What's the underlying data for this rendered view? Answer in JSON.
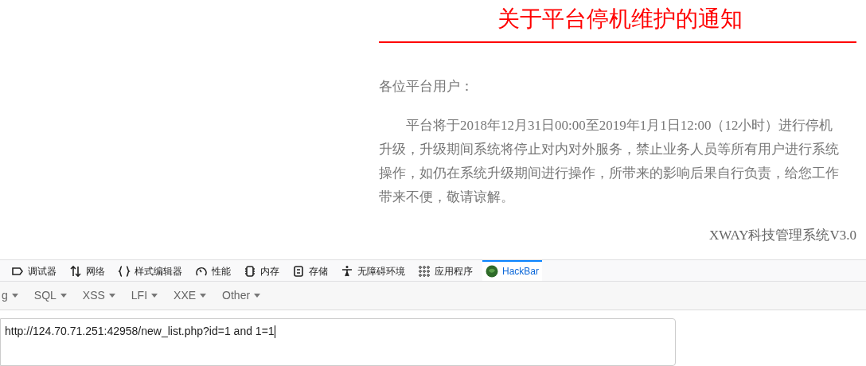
{
  "notice": {
    "title": "关于平台停机维护的通知",
    "greeting": "各位平台用户：",
    "body": "平台将于2018年12月31日00:00至2019年1月1日12:00（12小时）进行停机升级，升级期间系统将停止对内对外服务，禁止业务人员等所有用户进行系统操作，如仍在系统升级期间进行操作，所带来的影响后果自行负责，给您工作带来不便，敬请谅解。",
    "signature": "XWAY科技管理系统V3.0"
  },
  "devtools_tabs": [
    {
      "label": "调试器",
      "selected": false
    },
    {
      "label": "网络",
      "selected": false
    },
    {
      "label": "样式编辑器",
      "selected": false
    },
    {
      "label": "性能",
      "selected": false
    },
    {
      "label": "内存",
      "selected": false
    },
    {
      "label": "存储",
      "selected": false
    },
    {
      "label": "无障碍环境",
      "selected": false
    },
    {
      "label": "应用程序",
      "selected": false
    },
    {
      "label": "HackBar",
      "selected": true
    }
  ],
  "hackbar_menus": [
    "g",
    "SQL",
    "XSS",
    "LFI",
    "XXE",
    "Other"
  ],
  "url_field": {
    "value": "http://124.70.71.251:42958/new_list.php?id=1 and 1=1"
  }
}
